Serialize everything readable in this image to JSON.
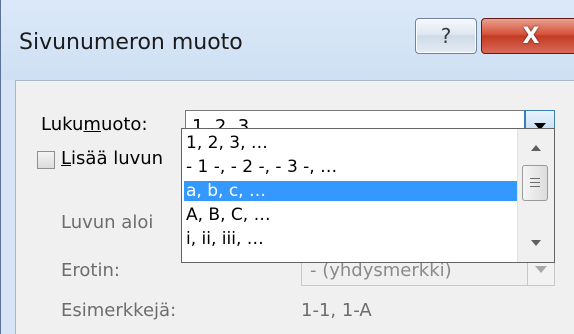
{
  "window": {
    "title": "Sivunumeron muoto",
    "help_glyph": "?",
    "close_glyph": "X"
  },
  "format": {
    "label_pre": "Luku",
    "label_mnemonic": "m",
    "label_post": "uoto:",
    "value": "1, 2, 3, …",
    "options": [
      "1, 2, 3, …",
      "- 1 -, - 2 -, - 3 -, …",
      "a, b, c, …",
      "A, B, C, …",
      "i, ii, iii, …"
    ],
    "highlighted_index": 2
  },
  "chapter": {
    "checkbox_mnemonic": "L",
    "checkbox_label": "isää luvun",
    "checked": false,
    "start_style_label": "Luvun aloi",
    "separator_label": "Erotin:",
    "separator_value": "-   (yhdysmerkki)",
    "examples_label": "Esimerkkejä:",
    "examples_value": "1-1, 1-A"
  },
  "icons": [
    "help-icon",
    "close-icon",
    "chevron-down-icon",
    "scroll-up-icon",
    "scroll-down-icon"
  ],
  "colors": {
    "selection": "#3399ff",
    "close_button": "#c23b22",
    "title_bar": "#d6e4f5"
  }
}
